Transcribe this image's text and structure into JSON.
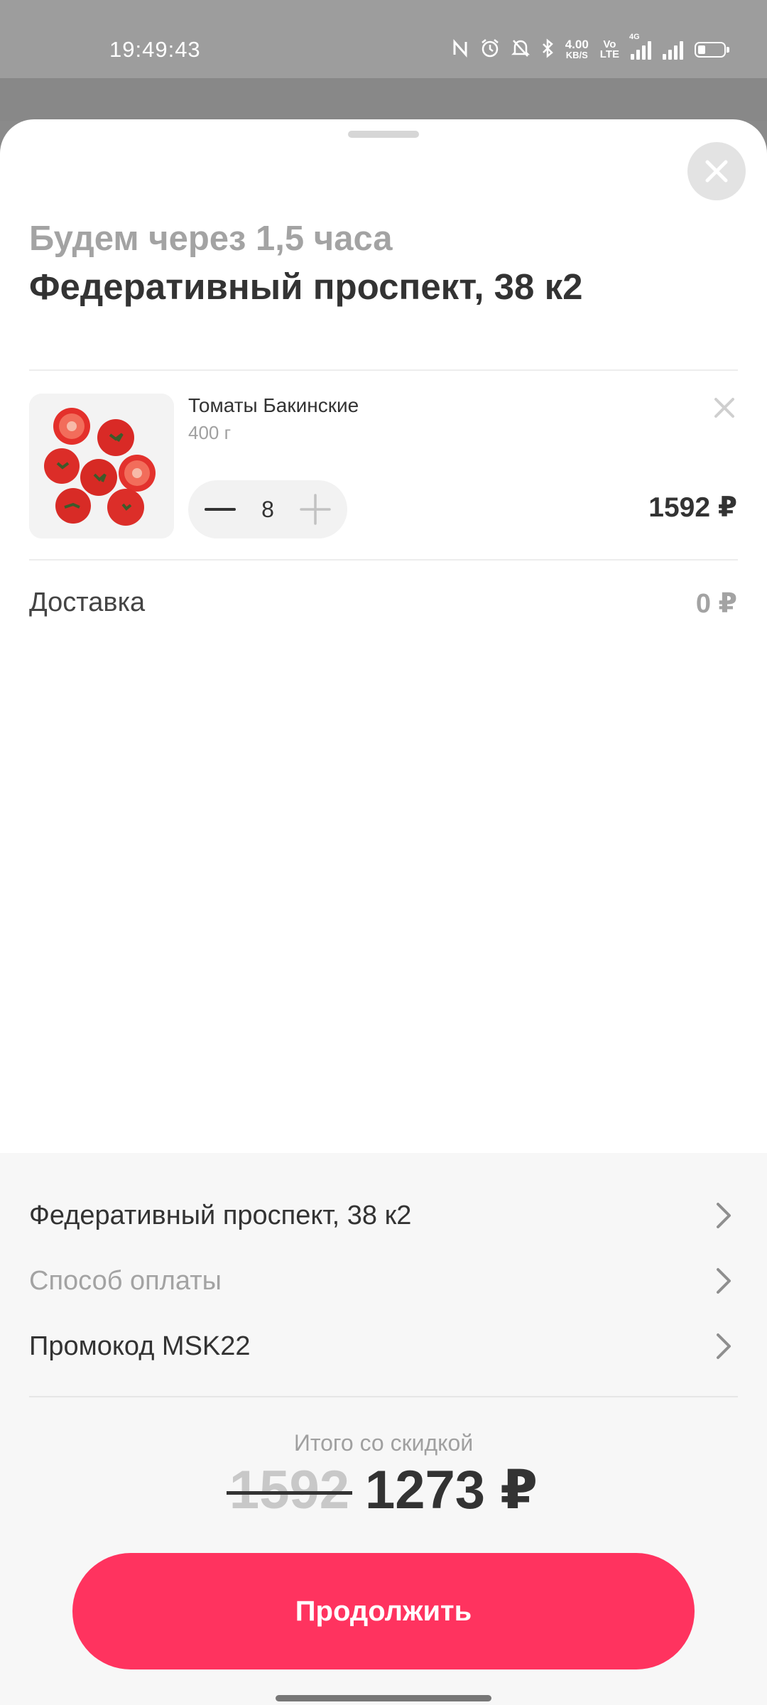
{
  "status_bar": {
    "time": "19:49:43",
    "net_speed_value": "4.00",
    "net_speed_unit": "KB/S",
    "volte_top": "Vo",
    "volte_bottom": "LTE",
    "network_type": "4G"
  },
  "sheet": {
    "eta": "Будем через 1,5 часа",
    "address_title": "Федеративный проспект, 38 к2"
  },
  "cart": {
    "items": [
      {
        "name": "Томаты Бакинские",
        "weight": "400 г",
        "quantity": "8",
        "price": "1592 ₽",
        "image_icon": "tomatoes-image"
      }
    ]
  },
  "delivery": {
    "label": "Доставка",
    "value": "0 ₽"
  },
  "summary": {
    "rows": [
      {
        "label": "Федеративный проспект, 38 к2",
        "muted": false
      },
      {
        "label": "Способ оплаты",
        "muted": true
      },
      {
        "label": "Промокод MSK22",
        "muted": false
      }
    ],
    "total_label": "Итого со скидкой",
    "old_total": "1592",
    "new_total": "1273 ₽"
  },
  "cta": {
    "label": "Продолжить"
  },
  "colors": {
    "accent": "#ff335f",
    "overlay": "#8a8a8a",
    "text_primary": "#333333",
    "text_muted": "#a3a3a3"
  }
}
